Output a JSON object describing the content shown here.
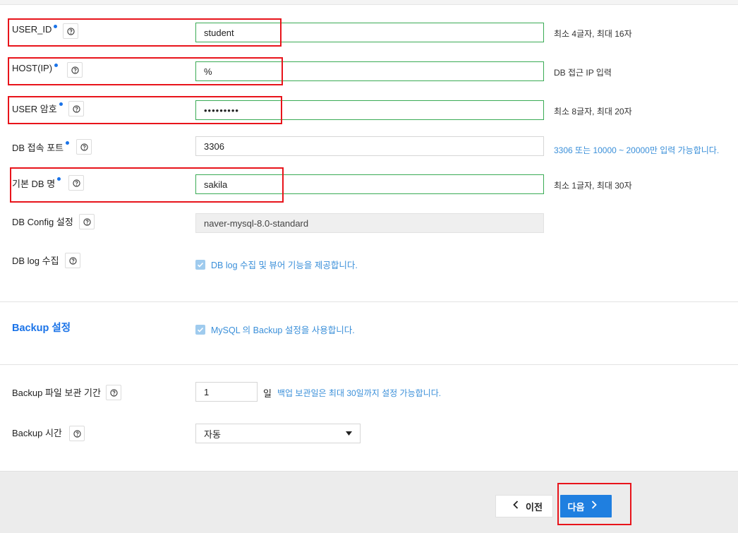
{
  "fields": {
    "user_id": {
      "label": "USER_ID",
      "value": "student",
      "hint": "최소 4글자, 최대 16자"
    },
    "host": {
      "label": "HOST(IP)",
      "value": "%",
      "hint": "DB 접근 IP 입력"
    },
    "user_pw": {
      "label": "USER 암호",
      "value": "•••••••••",
      "hint": "최소 8글자, 최대 20자"
    },
    "db_port": {
      "label": "DB 접속 포트",
      "value": "3306",
      "hint": "3306 또는 10000 ~ 20000만 입력 가능합니다."
    },
    "db_name": {
      "label": "기본 DB 명",
      "value": "sakila",
      "hint": "최소 1글자, 최대 30자"
    },
    "db_config": {
      "label": "DB Config 설정",
      "value": "naver-mysql-8.0-standard"
    },
    "db_log": {
      "label": "DB log 수집",
      "checkbox_label": "DB log 수집 및 뷰어 기능을 제공합니다."
    }
  },
  "backup": {
    "section_title": "Backup 설정",
    "enable_label": "MySQL 의 Backup 설정을 사용합니다.",
    "retention": {
      "label": "Backup 파일 보관 기간",
      "value": "1",
      "unit": "일",
      "hint": "백업 보관일은 최대 30일까지 설정 가능합니다."
    },
    "time": {
      "label": "Backup 시간",
      "selected": "자동"
    }
  },
  "footer": {
    "prev_label": "이전",
    "next_label": "다음"
  },
  "colors": {
    "accent": "#1f7fe0",
    "valid_border": "#3aab55",
    "annotation_red": "#e8141b",
    "hint_blue": "#3a8fd9"
  }
}
